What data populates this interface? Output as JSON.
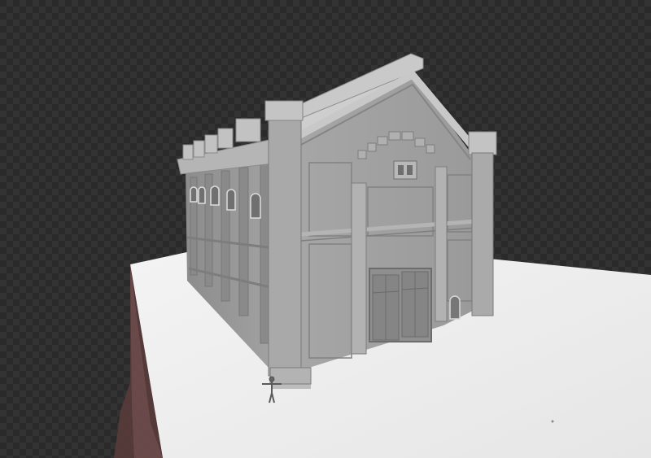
{
  "viewport": {
    "background": "transparency-checkerboard",
    "checker_colors": [
      "#2a2a2a",
      "#333333"
    ]
  },
  "scene": {
    "subject": "gothic-warehouse-3d-model",
    "ground_color": "#f0f0f0",
    "ground_shadow_color": "#6b4848",
    "building_color": "#9a9a9a",
    "human_scale_figure": true
  }
}
